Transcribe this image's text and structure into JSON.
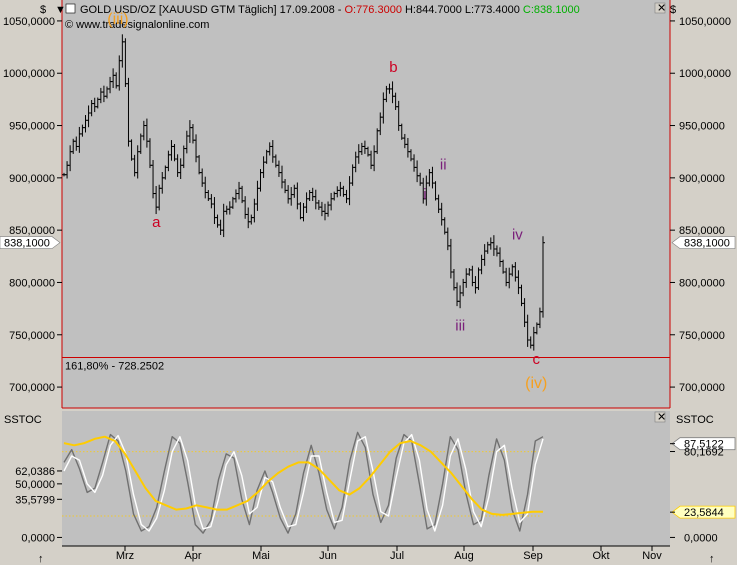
{
  "header": {
    "title_prefix": "GOLD USD/OZ [XAUUSD GTM  Täglich] 17.09.2008 -",
    "open": "O:776.3000",
    "high": "H:844.7000",
    "low": "L:773.4000",
    "close": "C:838.1000",
    "watermark": "© www.tradesignalonline.com"
  },
  "colors": {
    "panel_bg": "#c0c0c0",
    "frame_bg": "#d4d0c8",
    "price_bar": "#000000",
    "support_line": "#cc0000",
    "wave_major": "#f5a020",
    "wave_red": "#cc0022",
    "wave_purple": "#7a1f7a",
    "stoch_gray": "#707070",
    "stoch_white": "#ffffff",
    "stoch_yellow": "#ffcc00"
  },
  "chart_data": [
    {
      "type": "ohlc",
      "title": "GOLD USD/OZ [XAUUSD GTM Täglich]",
      "ylim": [
        680,
        1070
      ],
      "y_ticks": [
        1050,
        1000,
        950,
        900,
        850,
        800,
        750,
        700
      ],
      "y_tick_labels": [
        "1050,0000",
        "1000,0000",
        "950,0000",
        "900,0000",
        "850,0000",
        "800,0000",
        "750,0000",
        "700,0000"
      ],
      "x_labels": [
        "Mrz",
        "Apr",
        "Mai",
        "Jun",
        "Jul",
        "Aug",
        "Sep",
        "Okt",
        "Nov"
      ],
      "last_price": 838.1,
      "last_price_label": "838,1000",
      "support": {
        "value": 728.25,
        "label": "161,80% - 728.2502"
      },
      "waves": [
        {
          "label": "(iii)",
          "value": 1047,
          "x_frac": 0.092,
          "group": "major"
        },
        {
          "label": "a",
          "value": 853,
          "x_frac": 0.155,
          "group": "red"
        },
        {
          "label": "b",
          "value": 1001,
          "x_frac": 0.545,
          "group": "red"
        },
        {
          "label": "i",
          "value": 880,
          "x_frac": 0.597,
          "group": "purple"
        },
        {
          "label": "ii",
          "value": 908,
          "x_frac": 0.627,
          "group": "purple"
        },
        {
          "label": "iii",
          "value": 754,
          "x_frac": 0.655,
          "group": "purple"
        },
        {
          "label": "iv",
          "value": 841,
          "x_frac": 0.749,
          "group": "purple"
        },
        {
          "label": "c",
          "value": 722,
          "x_frac": 0.78,
          "group": "red"
        },
        {
          "label": "(iv)",
          "value": 699,
          "x_frac": 0.78,
          "group": "major"
        }
      ],
      "closes": [
        903,
        912,
        925,
        935,
        930,
        942,
        948,
        955,
        962,
        971,
        968,
        975,
        982,
        978,
        985,
        992,
        998,
        988,
        1012,
        1030,
        990,
        935,
        918,
        905,
        925,
        940,
        950,
        935,
        912,
        885,
        872,
        890,
        900,
        910,
        922,
        930,
        918,
        905,
        912,
        928,
        940,
        948,
        936,
        920,
        905,
        895,
        886,
        880,
        875,
        862,
        855,
        850,
        868,
        870,
        872,
        880,
        885,
        890,
        878,
        865,
        858,
        862,
        875,
        890,
        905,
        915,
        925,
        930,
        920,
        912,
        905,
        896,
        888,
        880,
        884,
        890,
        875,
        862,
        872,
        880,
        886,
        882,
        876,
        872,
        868,
        866,
        874,
        880,
        885,
        888,
        890,
        884,
        880,
        895,
        910,
        920,
        925,
        930,
        928,
        922,
        912,
        925,
        945,
        958,
        975,
        985,
        985,
        978,
        968,
        950,
        938,
        932,
        925,
        918,
        910,
        902,
        895,
        880,
        895,
        905,
        895,
        880,
        870,
        860,
        848,
        835,
        810,
        795,
        782,
        790,
        800,
        808,
        812,
        800,
        795,
        812,
        822,
        830,
        836,
        838,
        832,
        828,
        820,
        810,
        800,
        808,
        815,
        805,
        795,
        780,
        762,
        745,
        740,
        752,
        760,
        772,
        838
      ],
      "date_span": [
        "2008-02-01",
        "2008-09-17"
      ]
    },
    {
      "type": "line",
      "title": "SSTOC",
      "ylim": [
        -8,
        118
      ],
      "y_tick_labels": [
        "62,0386",
        "50,0000",
        "35,5799",
        "0,0000"
      ],
      "y_tick_values": [
        62.0386,
        50,
        35.5799,
        0
      ],
      "right_labels": [
        {
          "text": "87,5122",
          "value": 87.5122,
          "boxed": true
        },
        {
          "text": "80,1692",
          "value": 80.1692,
          "boxed": false
        },
        {
          "text": "23,5844",
          "value": 23.5844,
          "boxed": true,
          "yellow": true
        },
        {
          "text": "0,0000",
          "value": 0,
          "boxed": false
        }
      ],
      "bands": [
        80,
        20
      ],
      "series": [
        {
          "color": "#707070",
          "values": [
            70,
            82,
            64,
            42,
            46,
            70,
            96,
            90,
            62,
            22,
            6,
            10,
            28,
            62,
            94,
            88,
            52,
            12,
            4,
            16,
            54,
            78,
            74,
            36,
            12,
            44,
            62,
            42,
            18,
            4,
            22,
            60,
            86,
            60,
            26,
            8,
            28,
            72,
            98,
            84,
            40,
            14,
            30,
            74,
            96,
            90,
            50,
            8,
            12,
            50,
            94,
            82,
            42,
            12,
            16,
            58,
            92,
            72,
            26,
            6,
            40,
            90,
            94
          ]
        },
        {
          "color": "#ffffff",
          "values": [
            62,
            76,
            72,
            50,
            42,
            58,
            86,
            95,
            78,
            40,
            12,
            6,
            18,
            44,
            80,
            94,
            72,
            30,
            8,
            10,
            36,
            68,
            80,
            58,
            22,
            28,
            56,
            52,
            28,
            10,
            12,
            42,
            76,
            76,
            42,
            14,
            16,
            54,
            90,
            94,
            62,
            24,
            20,
            56,
            88,
            96,
            72,
            26,
            6,
            30,
            76,
            92,
            64,
            24,
            10,
            38,
            80,
            86,
            46,
            14,
            22,
            68,
            92
          ]
        },
        {
          "color": "#ffcc00",
          "values": [
            88,
            86,
            88,
            92,
            94,
            90,
            78,
            62,
            46,
            34,
            30,
            26,
            27,
            30,
            28,
            26,
            26,
            30,
            34,
            42,
            52,
            60,
            66,
            70,
            70,
            64,
            54,
            44,
            40,
            46,
            56,
            68,
            80,
            88,
            90,
            86,
            80,
            70,
            60,
            48,
            36,
            26,
            22,
            21,
            22,
            23,
            24,
            24
          ]
        }
      ]
    }
  ]
}
